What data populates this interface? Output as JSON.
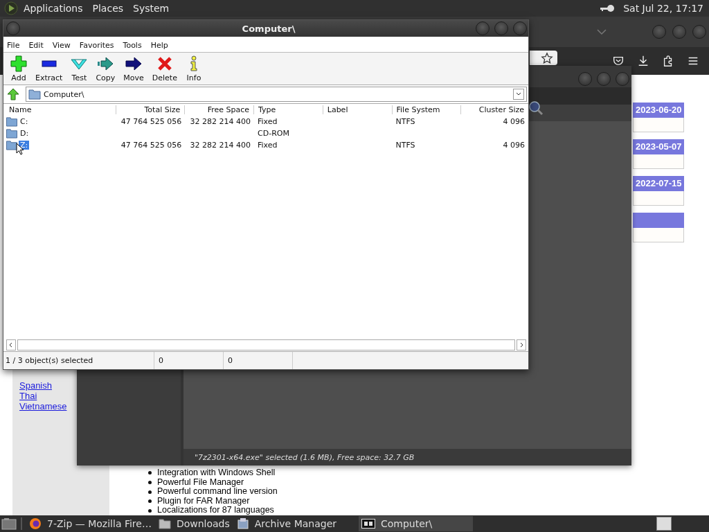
{
  "top_panel": {
    "menus": [
      "Applications",
      "Places",
      "System"
    ],
    "clock": "Sat Jul 22, 17:17"
  },
  "browser": {
    "links": [
      "Spanish",
      "Thai",
      "Vietnamese"
    ],
    "features": [
      "Integration with Windows Shell",
      "Powerful File Manager",
      "Powerful command line version",
      "Plugin for FAR Manager",
      "Localizations for 87 languages"
    ],
    "dates": [
      "2023-06-20",
      "2023-05-07",
      "2022-07-15"
    ]
  },
  "archive_manager": {
    "status": "\"7z2301-x64.exe\" selected (1.6 MB), Free space: 32.7 GB"
  },
  "zip_window": {
    "title": "Computer\\",
    "menu": [
      "File",
      "Edit",
      "View",
      "Favorites",
      "Tools",
      "Help"
    ],
    "toolbar": [
      {
        "label": "Add",
        "kind": "add"
      },
      {
        "label": "Extract",
        "kind": "extract"
      },
      {
        "label": "Test",
        "kind": "test"
      },
      {
        "label": "Copy",
        "kind": "copy"
      },
      {
        "label": "Move",
        "kind": "move"
      },
      {
        "label": "Delete",
        "kind": "delete"
      },
      {
        "label": "Info",
        "kind": "info"
      }
    ],
    "path": "Computer\\",
    "columns": [
      "Name",
      "Total Size",
      "Free Space",
      "Type",
      "Label",
      "File System",
      "Cluster Size"
    ],
    "rows": [
      {
        "cells": [
          "C:",
          "47 764 525 056",
          "32 282 214 400",
          "Fixed",
          null,
          "NTFS",
          "4 096"
        ],
        "selected": false
      },
      {
        "cells": [
          "D:",
          null,
          null,
          "CD-ROM",
          null,
          null,
          null
        ],
        "selected": false
      },
      {
        "cells": [
          "Z:",
          "47 764 525 056",
          "32 282 214 400",
          "Fixed",
          null,
          "NTFS",
          "4 096"
        ],
        "selected": true
      }
    ],
    "status": [
      "1 / 3 object(s) selected",
      "0",
      "0"
    ]
  },
  "taskbar": [
    {
      "label": "7-Zip — Mozilla Fire…",
      "kind": "firefox",
      "selected": false
    },
    {
      "label": "Downloads",
      "kind": "folder",
      "selected": false
    },
    {
      "label": "Archive Manager",
      "kind": "archive",
      "selected": false
    },
    {
      "label": "Computer\\",
      "kind": "sevenzip",
      "selected": true
    }
  ]
}
